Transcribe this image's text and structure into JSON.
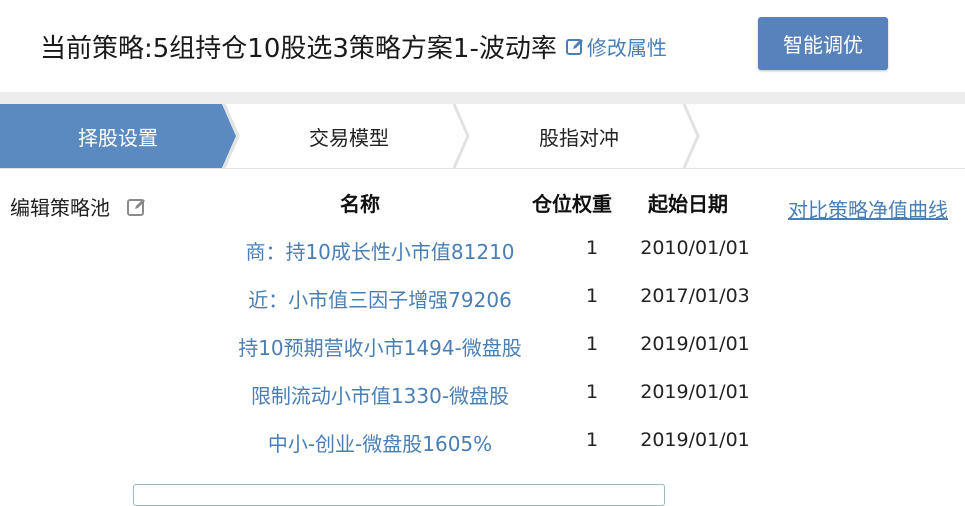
{
  "header": {
    "title_prefix": "当前策略: ",
    "strategy_name": "5组持仓10股选3策略方案1-波动率",
    "edit_attributes_label": "修改属性",
    "smart_tune_label": "智能调优"
  },
  "steps": [
    {
      "label": "择股设置",
      "active": true
    },
    {
      "label": "交易模型",
      "active": false
    },
    {
      "label": "股指对冲",
      "active": false
    }
  ],
  "pool": {
    "edit_label": "编辑策略池",
    "compare_link": "对比策略净值曲线"
  },
  "table": {
    "columns": {
      "name": "名称",
      "weight": "仓位权重",
      "start_date": "起始日期"
    },
    "rows": [
      {
        "name": "商：持10成长性小市值81210",
        "weight": "1",
        "start_date": "2010/01/01"
      },
      {
        "name": "近：小市值三因子增强79206",
        "weight": "1",
        "start_date": "2017/01/03"
      },
      {
        "name": "持10预期营收小市1494-微盘股",
        "weight": "1",
        "start_date": "2019/01/01"
      },
      {
        "name": "限制流动小市值1330-微盘股",
        "weight": "1",
        "start_date": "2019/01/01"
      },
      {
        "name": "中小-创业-微盘股1605%",
        "weight": "1",
        "start_date": "2019/01/01"
      }
    ]
  },
  "colors": {
    "accent": "#5782bc",
    "link": "#4a7fb5",
    "active_step": "#5b8ac1"
  }
}
